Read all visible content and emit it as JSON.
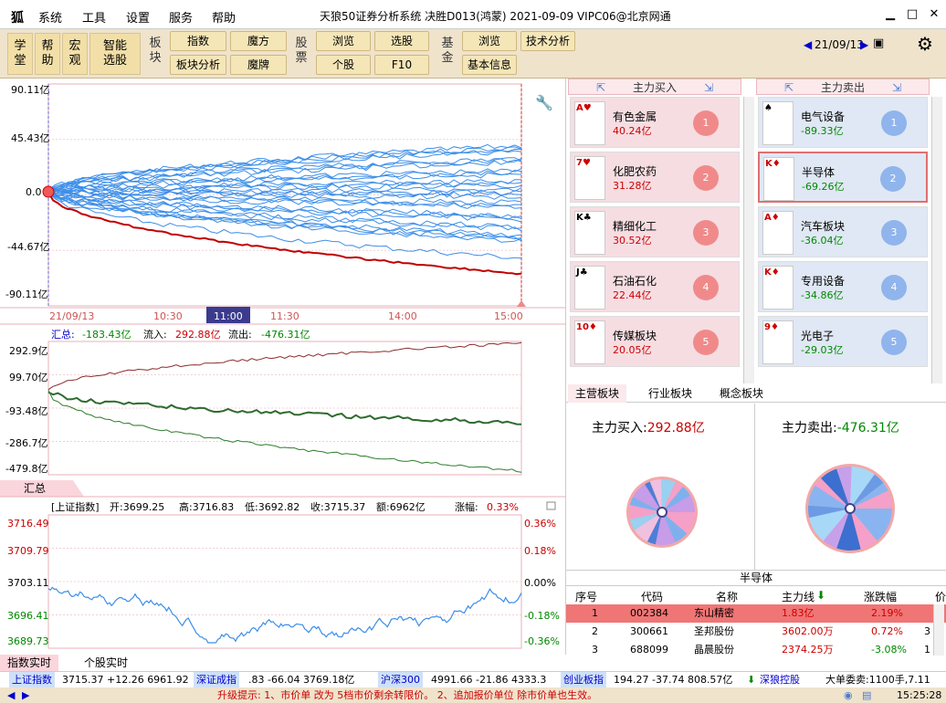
{
  "app": {
    "title": "天狼50证券分析系统 决胜D013(鸿蒙) 2021-09-09 VIPC06@北京网通"
  },
  "menu": {
    "system": "系统",
    "tools": "工具",
    "settings": "设置",
    "service": "服务",
    "help": "帮助"
  },
  "toolbar": {
    "learn": "学\n堂",
    "help": "帮\n助",
    "macro": "宏\n观",
    "smart": "智能\n选股",
    "sector": "板\n块",
    "index": "指数",
    "magic": "魔方",
    "sector_analysis": "板块分析",
    "magic_card": "魔牌",
    "stock": "股\n票",
    "browse": "浏览",
    "select": "选股",
    "single": "个股",
    "f10": "F10",
    "fund": "基\n金",
    "fund_browse": "浏览",
    "tech": "技术分析",
    "basic": "基本信息",
    "date_nav": "21/09/13"
  },
  "top_chart": {
    "yticks": [
      "90.11亿",
      "45.43亿",
      "0.0",
      "-44.67亿",
      "-90.11亿"
    ],
    "xticks": [
      "21/09/13",
      "10:30",
      "11:00",
      "11:30",
      "14:00",
      "15:00"
    ]
  },
  "mid_chart": {
    "summary_label": "汇总:",
    "summary_value": "-183.43亿",
    "inflow_label": "流入:",
    "inflow_value": "292.88亿",
    "outflow_label": "流出:",
    "outflow_value": "-476.31亿",
    "yticks": [
      "292.9亿",
      "99.70亿",
      "-93.48亿",
      "-286.7亿",
      "-479.8亿"
    ],
    "tab": "汇总"
  },
  "index_chart": {
    "header_label": "[上证指数]",
    "open": "开:3699.25",
    "high": "高:3716.83",
    "low": "低:3692.82",
    "close": "收:3715.37",
    "amount": "额:6962亿",
    "change_label": "涨幅:",
    "change_value": "0.33%",
    "yticks_left": [
      "3716.49",
      "3709.79",
      "3703.11",
      "3696.41",
      "3689.73"
    ],
    "yticks_right": [
      "0.36%",
      "0.18%",
      "0.00%",
      "-0.18%",
      "-0.36%"
    ]
  },
  "bottom_tabs": {
    "index_rt": "指数实时",
    "stock_rt": "个股实时"
  },
  "buy_col": {
    "title": "主力买入",
    "cards": [
      {
        "name": "有色金属",
        "value": "40.24亿",
        "rank": "1",
        "suit": "A♥"
      },
      {
        "name": "化肥农药",
        "value": "31.28亿",
        "rank": "2",
        "suit": "7♥"
      },
      {
        "name": "精细化工",
        "value": "30.52亿",
        "rank": "3",
        "suit": "K♣"
      },
      {
        "name": "石油石化",
        "value": "22.44亿",
        "rank": "4",
        "suit": "J♣"
      },
      {
        "name": "传媒板块",
        "value": "20.05亿",
        "rank": "5",
        "suit": "10♦"
      }
    ]
  },
  "sell_col": {
    "title": "主力卖出",
    "cards": [
      {
        "name": "电气设备",
        "value": "-89.33亿",
        "rank": "1",
        "suit": "♠"
      },
      {
        "name": "半导体",
        "value": "-69.26亿",
        "rank": "2",
        "suit": "K♦"
      },
      {
        "name": "汽车板块",
        "value": "-36.04亿",
        "rank": "3",
        "suit": "A♦"
      },
      {
        "name": "专用设备",
        "value": "-34.86亿",
        "rank": "4",
        "suit": "K♦"
      },
      {
        "name": "光电子",
        "value": "-29.03亿",
        "rank": "5",
        "suit": "9♦"
      }
    ]
  },
  "side_tabs": {
    "main": "主营板块",
    "industry": "行业板块",
    "concept": "概念板块"
  },
  "flow": {
    "buy_label": "主力买入:",
    "buy_value": "292.88亿",
    "sell_label": "主力卖出:",
    "sell_value": "-476.31亿"
  },
  "table": {
    "title": "半导体",
    "headers": [
      "序号",
      "代码",
      "名称",
      "主力线",
      "涨跌幅",
      "价"
    ],
    "rows": [
      {
        "no": "1",
        "code": "002384",
        "name": "东山精密",
        "flow": "1.83亿",
        "chg": "2.19%",
        "price": ""
      },
      {
        "no": "2",
        "code": "300661",
        "name": "圣邦股份",
        "flow": "3602.00万",
        "chg": "0.72%",
        "price": "3"
      },
      {
        "no": "3",
        "code": "688099",
        "name": "晶晨股份",
        "flow": "2374.25万",
        "chg": "-3.08%",
        "price": "1"
      }
    ]
  },
  "ticker": {
    "sh": "上证指数",
    "sh_vals": "3715.37  +12.26  6961.92",
    "sz": "深证成指",
    "sz_vals": ".83  -66.04  3769.18亿",
    "hs": "沪深300",
    "hs_vals": "4991.66  -21.86  4333.3",
    "cy": "创业板指",
    "cy_vals": "194.27  -37.74  808.57亿",
    "tl": "深狼控股",
    "tl_vals": "大单委卖:1100手,7.11"
  },
  "status": {
    "tip": "升级提示: 1、市价单 改为 5档市价剩余转限价。 2、追加报价单位 除市价单也生效。",
    "time": "15:25:28"
  },
  "colors": {
    "red": "#c00000",
    "blue": "#3d8ee8",
    "green": "#2e6b2e"
  }
}
